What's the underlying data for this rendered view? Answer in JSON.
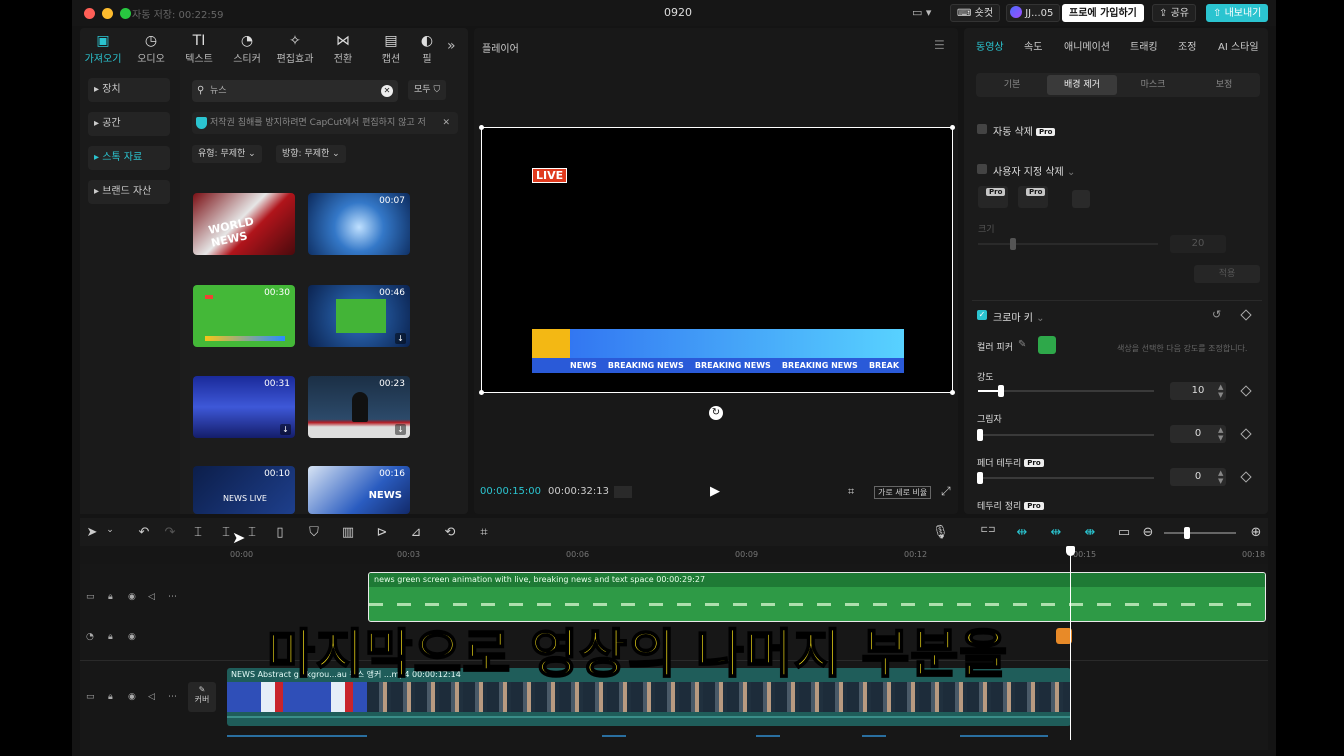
{
  "window": {
    "title": "0920",
    "autosave": "자동 저장: 00:22:59"
  },
  "topbar": {
    "shortcuts": "숏컷",
    "user": "JJ...05",
    "join_pro": "프로에 가입하기",
    "share": "공유",
    "export": "내보내기"
  },
  "media_tabs": [
    {
      "label": "가져오기",
      "icon": "import-icon",
      "glyph": "▣"
    },
    {
      "label": "오디오",
      "icon": "audio-icon",
      "glyph": "◷"
    },
    {
      "label": "텍스트",
      "icon": "text-icon",
      "glyph": "TI"
    },
    {
      "label": "스티커",
      "icon": "sticker-icon",
      "glyph": "◔"
    },
    {
      "label": "편집효과",
      "icon": "effects-icon",
      "glyph": "✧"
    },
    {
      "label": "전환",
      "icon": "transition-icon",
      "glyph": "⋈"
    },
    {
      "label": "캡션",
      "icon": "caption-icon",
      "glyph": "▤"
    },
    {
      "label": "필",
      "icon": "filter-icon",
      "glyph": "◐"
    }
  ],
  "sidebar": [
    "장치",
    "공간",
    "스톡 자료",
    "브랜드 자산"
  ],
  "search": {
    "value": "뉴스",
    "filter_all": "모두"
  },
  "copyright_notice": "저작권 침해를 방지하려면 CapCut에서 편집하지 않고 저",
  "filters": {
    "type": "유형: 무제한",
    "orientation": "방향: 무제한"
  },
  "thumbnails": [
    {
      "duration": "",
      "text": "WORLD NEWS",
      "download": false
    },
    {
      "duration": "00:07",
      "text": "",
      "download": false
    },
    {
      "duration": "00:30",
      "text": "",
      "download": false
    },
    {
      "duration": "00:46",
      "text": "",
      "download": true
    },
    {
      "duration": "00:31",
      "text": "",
      "download": true
    },
    {
      "duration": "00:23",
      "text": "",
      "download": true
    },
    {
      "duration": "00:10",
      "text": "NEWS LIVE",
      "download": false
    },
    {
      "duration": "00:16",
      "text": "NEWS",
      "download": false
    }
  ],
  "player": {
    "title": "플레이어",
    "live": "LIVE",
    "ticker": "NEWS    BREAKING NEWS    BREAKING NEWS    BREAKING NEWS    BREAK",
    "current_time": "00:00:15:00",
    "total_time": "00:00:32:13",
    "ratio": "가로 세로 비율"
  },
  "props": {
    "tabs": [
      "동영상",
      "속도",
      "애니메이션",
      "트래킹",
      "조정",
      "AI 스타일"
    ],
    "subtabs": [
      "기본",
      "배경 제거",
      "마스크",
      "보정"
    ],
    "auto_remove": "자동 삭제",
    "custom_remove": "사용자 지정 삭제",
    "pro": "Pro",
    "size_label": "크기",
    "size_value": "20",
    "apply": "적용",
    "chroma_key": "크로마 키",
    "color_picker": "컬러 피커",
    "picker_hint": "색상을 선택한 다음 강도를 조정합니다.",
    "picked_color": "#2ea84a",
    "intensity_label": "강도",
    "intensity_value": "10",
    "intensity_level": 0.13,
    "shadow_label": "그림자",
    "shadow_value": "0",
    "feather_label": "페더 테두리",
    "feather_value": "0",
    "edge_label": "테두리 정리"
  },
  "timeline": {
    "ticks": [
      "00:00",
      "00:03",
      "00:06",
      "00:09",
      "00:12",
      "00:15",
      "00:18"
    ],
    "overlay_clip": "news green screen animation with live, breaking news and text space  00:00:29:27",
    "main_clip": "NEWS Abstract g...kgrou...au 뉴스 앵커 ...mp4  00:00:12:14",
    "cover": "커버"
  },
  "subtitle": "마지막으로 영상의 나머지 부분을"
}
